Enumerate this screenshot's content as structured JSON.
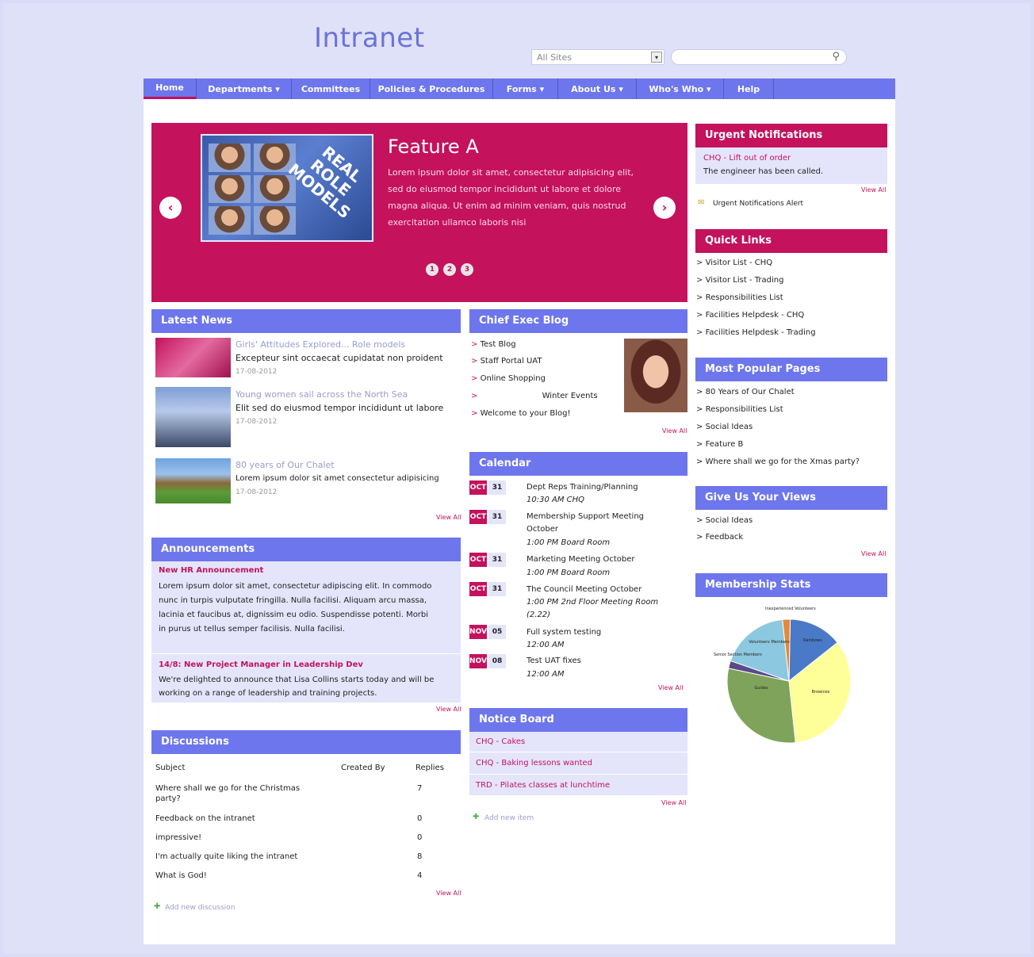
{
  "logo": "Intranet",
  "search": {
    "site_scope": "All Sites",
    "placeholder": ""
  },
  "colors": {
    "primary": "#6d76ec",
    "accent": "#c4125d",
    "panel_bg": "#e4e5fb",
    "page_bg": "#dfe1f8"
  },
  "nav": [
    {
      "label": "Home"
    },
    {
      "label": "Departments ▾"
    },
    {
      "label": "Committees"
    },
    {
      "label": "Policies & Procedures"
    },
    {
      "label": "Forms ▾"
    },
    {
      "label": "About Us ▾"
    },
    {
      "label": "Who's Who ▾"
    },
    {
      "label": "Help"
    }
  ],
  "carousel": {
    "title": "Feature A",
    "text": "Lorem ipsum dolor sit amet, consectetur adipisicing elit, sed do eiusmod tempor incididunt ut labore et dolore magna aliqua. Ut enim ad minim veniam, quis nostrud exercitation ullamco laboris nisi",
    "image_text": "REAL ROLE MODELS",
    "prev_icon": "‹",
    "next_icon": "›",
    "dots": [
      "1",
      "2",
      "3"
    ]
  },
  "latest_news": {
    "title": "Latest News",
    "items": [
      {
        "headline": "Girls' Attitudes Explored... Role models",
        "summary": "Excepteur sint occaecat cupidatat non proident",
        "date": "17-08-2012"
      },
      {
        "headline": "Young women sail across the North Sea",
        "summary": "Elit sed do eiusmod tempor incididunt ut labore",
        "date": "17-08-2012"
      },
      {
        "headline": "80 years of Our Chalet",
        "summary": "Lorem ipsum dolor sit amet consectetur adipisicing",
        "date": "17-08-2012"
      }
    ],
    "view_all": "View All"
  },
  "announcements": {
    "title": "Announcements",
    "items": [
      {
        "headline": "New HR Announcement",
        "lines": [
          "Lorem ipsum dolor sit amet, consectetur adipiscing elit. In commodo",
          "nunc in turpis vulputate fringilla. Nulla facilisi. Aliquam arcu massa,",
          "lacinia et faucibus at, dignissim eu odio. Suspendisse potenti. Morbi",
          "in purus ut tellus semper facilisis. Nulla facilisi."
        ]
      },
      {
        "headline": "14/8: New Project Manager in Leadership Dev",
        "lines": [
          "We're delighted to announce that Lisa Collins starts today and will be",
          "working on a range of leadership and training projects."
        ]
      }
    ],
    "view_all": "View All"
  },
  "discussions": {
    "title": "Discussions",
    "columns": [
      "Subject",
      "Created By",
      "Replies"
    ],
    "rows": [
      {
        "subject": "Where shall we go for the Christmas",
        "subject2": "party?",
        "created_by": "",
        "replies": "7"
      },
      {
        "subject": "Feedback on the intranet",
        "subject2": "",
        "created_by": "",
        "replies": "0"
      },
      {
        "subject": "impressive!",
        "subject2": "",
        "created_by": "",
        "replies": "0"
      },
      {
        "subject": "I'm actually quite liking the intranet",
        "subject2": "",
        "created_by": "",
        "replies": "8"
      },
      {
        "subject": "What is God!",
        "subject2": "",
        "created_by": "",
        "replies": "4"
      }
    ],
    "view_all": "View All",
    "add_new": "Add new discussion"
  },
  "blog": {
    "title": "Chief Exec Blog",
    "items": [
      "Test Blog",
      "Staff Portal UAT",
      "Online Shopping",
      "Winter Events",
      "Welcome to your Blog!"
    ],
    "view_all": "View All"
  },
  "calendar": {
    "title": "Calendar",
    "events": [
      {
        "month": "OCT",
        "day": "31",
        "title": "Dept Reps Training/Planning",
        "title2": "",
        "time": "10:30 AM CHQ",
        "time2": ""
      },
      {
        "month": "OCT",
        "day": "31",
        "title": "Membership Support Meeting",
        "title2": "October",
        "time": "1:00 PM Board Room",
        "time2": ""
      },
      {
        "month": "OCT",
        "day": "31",
        "title": "Marketing Meeting October",
        "title2": "",
        "time": "1:00 PM Board Room",
        "time2": ""
      },
      {
        "month": "OCT",
        "day": "31",
        "title": "The Council Meeting October",
        "title2": "",
        "time": "1:00 PM 2nd Floor Meeting Room",
        "time2": "(2.22)"
      },
      {
        "month": "NOV",
        "day": "05",
        "title": "Full system testing",
        "title2": "",
        "time": "12:00 AM",
        "time2": ""
      },
      {
        "month": "NOV",
        "day": "08",
        "title": "Test UAT fixes",
        "title2": "",
        "time": "12:00 AM",
        "time2": ""
      }
    ],
    "view_all": "View All"
  },
  "notice_board": {
    "title": "Notice Board",
    "items": [
      "CHQ - Cakes",
      "CHQ - Baking lessons wanted",
      "TRD - Pilates classes at lunchtime"
    ],
    "view_all": "View All",
    "add_new": "Add new item"
  },
  "urgent": {
    "title": "Urgent Notifications",
    "item_title": "CHQ - Lift out of order",
    "item_text": "The engineer has been called.",
    "view_all": "View All",
    "alert": "Urgent Notifications Alert"
  },
  "quick_links": {
    "title": "Quick Links",
    "items": [
      "Visitor List - CHQ",
      "Visitor List - Trading",
      "Responsibilities List",
      "Facilities Helpdesk - CHQ",
      "Facilities Helpdesk - Trading"
    ]
  },
  "popular": {
    "title": "Most Popular Pages",
    "items": [
      "80 Years of Our Chalet",
      "Responsibilities List",
      "Social Ideas",
      "Feature B",
      "Where shall we go for the Xmas party?"
    ]
  },
  "views": {
    "title": "Give Us Your Views",
    "items": [
      "Social Ideas",
      "Feedback"
    ],
    "view_all": "View All"
  },
  "stats": {
    "title": "Membership Stats",
    "chart_data": {
      "type": "pie",
      "series": [
        {
          "name": "Rainbows",
          "value": 14,
          "color": "#4a79c8"
        },
        {
          "name": "Brownies",
          "value": 34,
          "color": "#ffff99"
        },
        {
          "name": "Guides",
          "value": 30,
          "color": "#7fa35a"
        },
        {
          "name": "Senior Section Members",
          "value": 2,
          "color": "#5a4a8a"
        },
        {
          "name": "Volunteers Members",
          "value": 18,
          "color": "#8cc8e0"
        },
        {
          "name": "Inexperienced Volunteers",
          "value": 2,
          "color": "#e08a3a"
        }
      ]
    }
  }
}
